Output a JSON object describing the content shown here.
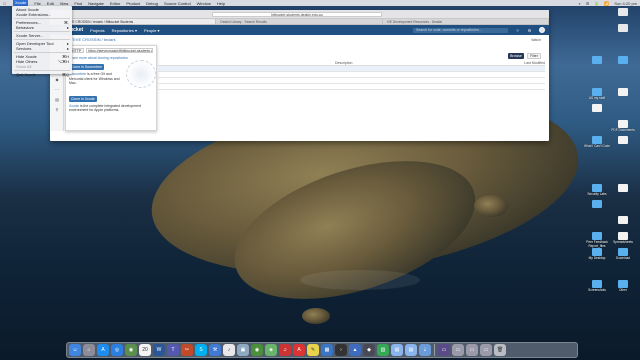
{
  "menubar": {
    "apple": "",
    "app_name": "Xcode",
    "items": [
      "File",
      "Edit",
      "View",
      "Find",
      "Navigate",
      "Editor",
      "Product",
      "Debug",
      "Source Control",
      "Window",
      "Help"
    ],
    "clock": "Sun 4:20 pm",
    "status_icons": [
      "⌕",
      "☰",
      "🔋",
      "📶"
    ]
  },
  "app_menu": {
    "items": [
      {
        "label": "About Xcode",
        "shortcut": ""
      },
      {
        "label": "Xcode Extensions...",
        "shortcut": ""
      },
      {
        "sep": true
      },
      {
        "label": "Preferences...",
        "shortcut": "⌘,"
      },
      {
        "label": "Behaviors",
        "shortcut": "▸"
      },
      {
        "sep": true
      },
      {
        "label": "Xcode Server...",
        "shortcut": ""
      },
      {
        "sep": true
      },
      {
        "label": "Open Developer Tool",
        "shortcut": "▸"
      },
      {
        "label": "Services",
        "shortcut": "▸"
      },
      {
        "sep": true
      },
      {
        "label": "Hide Xcode",
        "shortcut": "⌘H"
      },
      {
        "label": "Hide Others",
        "shortcut": "⌥⌘H"
      },
      {
        "label": "Show All",
        "shortcut": "",
        "dim": true
      },
      {
        "sep": true
      },
      {
        "label": "Quit Xcode",
        "shortcut": "⌘Q"
      }
    ]
  },
  "browser": {
    "url": "bitbucket-students.deakin.edu.au",
    "tabs": [
      "Home STEVE CROSSIN / teclark / Bitbucket Students",
      "Deakin Library - Search Results",
      "XIE Development Resources - Deakin"
    ],
    "active_tab": 0
  },
  "bitbucket": {
    "logo": "Bitbucket",
    "nav": [
      "Projects",
      "Repositories ▾",
      "People ▾"
    ],
    "search_placeholder": "Search for code, commits or repositories...",
    "help_icon": "?",
    "settings_icon": "⚙",
    "breadcrumb": "STEVE CROSSIN  /  teclark",
    "watch": "Watch",
    "browse": "Browse",
    "filter": "Filter",
    "clone": {
      "protocol": "HTTP",
      "url": "https://stevecrossin@bitbucket-students.deakin.edu.au/scm/...",
      "learn": "Learn more about cloning repositories",
      "sourcetree_btn": "Clone in Sourcetree",
      "sourcetree_name": "Sourcetree",
      "sourcetree_text": " is a free Git and Mercurial client for Windows and Mac.",
      "xcode_btn": "Clone in Xcode",
      "xcode_name": "Xcode",
      "xcode_text": " is the complete integrated development environment for Apple platforms."
    },
    "table_header": {
      "name": "",
      "description": "Description",
      "last_modified": "Last Modified"
    },
    "sidebar_icons": [
      "✎",
      "⎘",
      "⇲",
      "⤴",
      "◆",
      "⋯",
      "▤",
      "⚲"
    ]
  },
  "desktop": {
    "icons": [
      {
        "label": "",
        "color": "#e8e8ea"
      },
      {
        "label": "",
        "color": "#e8e8ea"
      },
      {
        "label": "",
        "color": "#5ab0ef"
      },
      {
        "label": "",
        "color": "#5ab0ef"
      },
      {
        "label": "AS my stuff",
        "color": "#5ab0ef"
      },
      {
        "label": "",
        "color": "#f3f3f3"
      },
      {
        "label": "",
        "color": "#f3f3f3"
      },
      {
        "label": "PDF Documents",
        "color": "#f3f3f3"
      },
      {
        "label": "What I Can't Code",
        "color": "#5ab0ef"
      },
      {
        "label": "",
        "color": "#f3f3f3"
      },
      {
        "label": "Security Labs",
        "color": "#5ab0ef"
      },
      {
        "label": "",
        "color": "#f3f3f3"
      },
      {
        "label": "",
        "color": "#5ab0ef"
      },
      {
        "label": "",
        "color": "#f3f3f3"
      },
      {
        "label": "Peer Feedback Report_files",
        "color": "#5ab0ef"
      },
      {
        "label": "Spreadsheets",
        "color": "#f3f3f3"
      },
      {
        "label": "My Desktop",
        "color": "#5ab0ef"
      },
      {
        "label": "Download",
        "color": "#5ab0ef"
      },
      {
        "label": "Screenshots",
        "color": "#5ab0ef"
      },
      {
        "label": "Other",
        "color": "#5ab0ef"
      }
    ]
  },
  "dock": {
    "apps": [
      {
        "name": "Finder",
        "color": "#3e86e0",
        "glyph": "☺"
      },
      {
        "name": "Launchpad",
        "color": "#8d8d9a",
        "glyph": "⌂"
      },
      {
        "name": "App Store",
        "color": "#1d8cf0",
        "glyph": "A"
      },
      {
        "name": "Safari",
        "color": "#2a7fe0",
        "glyph": "◎"
      },
      {
        "name": "Chrome",
        "color": "#5a8f4e",
        "glyph": "◉"
      },
      {
        "name": "Calendar",
        "color": "#f4f4f4",
        "glyph": "20"
      },
      {
        "name": "Word",
        "color": "#2b5797",
        "glyph": "W"
      },
      {
        "name": "Teams",
        "color": "#5558af",
        "glyph": "T"
      },
      {
        "name": "Tools",
        "color": "#c04a2a",
        "glyph": "✂"
      },
      {
        "name": "Skype",
        "color": "#00aff0",
        "glyph": "S"
      },
      {
        "name": "Xcode",
        "color": "#3f7ad4",
        "glyph": "⚒"
      },
      {
        "name": "iTunes",
        "color": "#e8e8ea",
        "glyph": "♪"
      },
      {
        "name": "Preview",
        "color": "#8fa9c0",
        "glyph": "▣"
      },
      {
        "name": "Chrome",
        "color": "#4b8f3a",
        "glyph": "◉"
      },
      {
        "name": "Maps",
        "color": "#6ab36a",
        "glyph": "◈"
      },
      {
        "name": "Music",
        "color": "#c33",
        "glyph": "♫"
      },
      {
        "name": "Acrobat",
        "color": "#d33",
        "glyph": "A"
      },
      {
        "name": "Notes",
        "color": "#e9d34c",
        "glyph": "✎"
      },
      {
        "name": "Folder",
        "color": "#3a76c4",
        "glyph": "▦"
      },
      {
        "name": "Terminal",
        "color": "#333",
        "glyph": "›"
      },
      {
        "name": "Keynote",
        "color": "#3e6cc0",
        "glyph": "▲"
      },
      {
        "name": "App",
        "color": "#4a4a56",
        "glyph": "◆"
      },
      {
        "name": "Numbers",
        "color": "#34a853",
        "glyph": "▥"
      },
      {
        "name": "Folder",
        "color": "#8ab4ec",
        "glyph": "▤"
      },
      {
        "name": "Folder",
        "color": "#8ab4ec",
        "glyph": "▤"
      },
      {
        "name": "Downloads",
        "color": "#6b9bd8",
        "glyph": "⇣"
      },
      {
        "name": "Screens",
        "color": "#5a4a8a",
        "glyph": "▭"
      },
      {
        "name": "Window",
        "color": "#9a9aaa",
        "glyph": "▭"
      },
      {
        "name": "Window",
        "color": "#9a9aaa",
        "glyph": "▭"
      },
      {
        "name": "Window",
        "color": "#9a9aaa",
        "glyph": "▭"
      },
      {
        "name": "Trash",
        "color": "#b8bcc4",
        "glyph": "🗑"
      }
    ]
  }
}
